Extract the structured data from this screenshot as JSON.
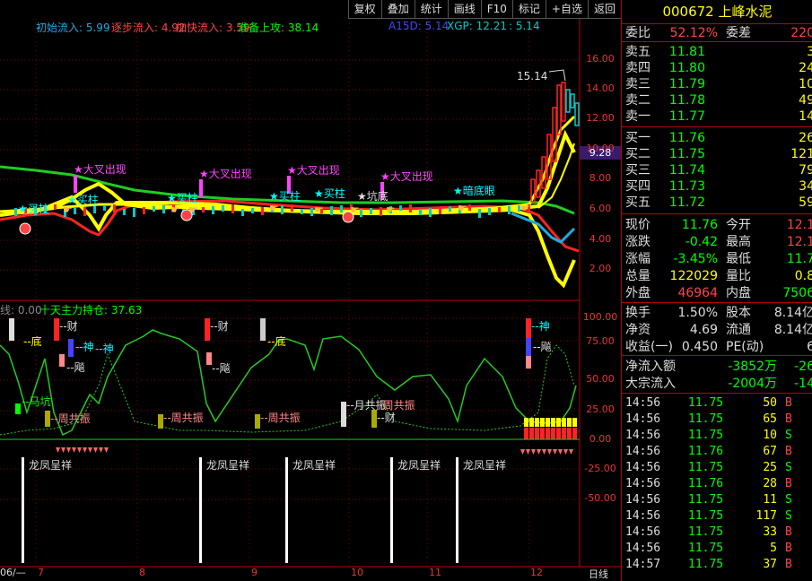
{
  "toolbar": [
    "复权",
    "叠加",
    "统计",
    "画线",
    "F10",
    "标记",
    "+自选",
    "返回"
  ],
  "indicators_top": [
    {
      "label": "初始流入: 5.99",
      "color": "#2ad"
    },
    {
      "label": "逐步流入: 4.92",
      "color": "#f44"
    },
    {
      "label": "加快流入: 3.59",
      "color": "#f44"
    },
    {
      "label": "准备上攻: 38.14",
      "color": "#0f0"
    },
    {
      "label": "A15D: 5.14",
      "color": "#44f"
    },
    {
      "label": "XGP: 12.21",
      "color": "#0cc"
    },
    {
      "label": ": 5.14",
      "color": "#0cc"
    }
  ],
  "top_axis": [
    "16.00",
    "14.00",
    "12.00",
    "10.00",
    "8.00",
    "6.00",
    "4.00",
    "2.00"
  ],
  "price_tag": "9.28",
  "peak_label": "15.14",
  "top_marks": [
    {
      "text": "大叉出现",
      "color": "#f4f"
    },
    {
      "text": "大叉出现",
      "color": "#f4f"
    },
    {
      "text": "大叉出现",
      "color": "#f4f"
    },
    {
      "text": "大叉出现",
      "color": "#f4f"
    },
    {
      "text": "买柱",
      "color": "#0ff"
    },
    {
      "text": "买柱",
      "color": "#0ff"
    },
    {
      "text": "买柱",
      "color": "#0ff"
    },
    {
      "text": "买柱",
      "color": "#0ff"
    },
    {
      "text": "买柱",
      "color": "#0ff"
    },
    {
      "text": "坑底",
      "color": "#ddd"
    },
    {
      "text": "暗底眼",
      "color": "#0ff"
    }
  ],
  "mid_indicators": [
    {
      "label": "线: 0.00",
      "color": "#888"
    },
    {
      "label": "十天主力持仓: 37.63",
      "color": "#0f0"
    }
  ],
  "mid_axis": [
    "100.00",
    "75.00",
    "50.00",
    "25.00",
    "0.00",
    "-25.00",
    "-50.00"
  ],
  "mid_marks": [
    {
      "text": "底",
      "color": "#ff0"
    },
    {
      "text": "财",
      "color": "#ddd"
    },
    {
      "text": "神",
      "color": "#0ff"
    },
    {
      "text": "神",
      "color": "#0ff"
    },
    {
      "text": "飚",
      "color": "#ddd"
    },
    {
      "text": "马坑",
      "color": "#0f0"
    },
    {
      "text": "周共振",
      "color": "#f88"
    },
    {
      "text": "财",
      "color": "#ddd"
    },
    {
      "text": "底",
      "color": "#ff0"
    },
    {
      "text": "飚",
      "color": "#ddd"
    },
    {
      "text": "周共振",
      "color": "#f88"
    },
    {
      "text": "周共振",
      "color": "#f88"
    },
    {
      "text": "月共振",
      "color": "#ddd"
    },
    {
      "text": "周共振",
      "color": "#f88"
    },
    {
      "text": "财",
      "color": "#ddd"
    },
    {
      "text": "神",
      "color": "#0ff"
    },
    {
      "text": "飚",
      "color": "#ddd"
    }
  ],
  "dragon_label": "龙凤呈祥",
  "dragon_count": 5,
  "x_labels": [
    "06/—",
    "7",
    "8",
    "9",
    "10",
    "11",
    "12"
  ],
  "period": "日线",
  "stock": {
    "code": "000672",
    "name": "上峰水泥"
  },
  "weibi": {
    "label": "委比",
    "value": "52.12%",
    "label2": "委差",
    "value2": "220"
  },
  "asks": [
    {
      "label": "卖五",
      "price": "11.81",
      "vol": "3"
    },
    {
      "label": "卖四",
      "price": "11.80",
      "vol": "24"
    },
    {
      "label": "卖三",
      "price": "11.79",
      "vol": "10"
    },
    {
      "label": "卖二",
      "price": "11.78",
      "vol": "49"
    },
    {
      "label": "卖一",
      "price": "11.77",
      "vol": "14"
    }
  ],
  "bids": [
    {
      "label": "买一",
      "price": "11.76",
      "vol": "26"
    },
    {
      "label": "买二",
      "price": "11.75",
      "vol": "121"
    },
    {
      "label": "买三",
      "price": "11.74",
      "vol": "79"
    },
    {
      "label": "买四",
      "price": "11.73",
      "vol": "34"
    },
    {
      "label": "买五",
      "price": "11.72",
      "vol": "59"
    }
  ],
  "quote": [
    {
      "l1": "现价",
      "v1": "11.76",
      "c1": "g",
      "l2": "今开",
      "v2": "12.1",
      "c2": "r"
    },
    {
      "l1": "涨跌",
      "v1": "-0.42",
      "c1": "g",
      "l2": "最高",
      "v2": "12.1",
      "c2": "r"
    },
    {
      "l1": "涨幅",
      "v1": "-3.45%",
      "c1": "g",
      "l2": "最低",
      "v2": "11.7",
      "c2": "g"
    },
    {
      "l1": "总量",
      "v1": "122029",
      "c1": "y",
      "l2": "量比",
      "v2": "0.8",
      "c2": "y"
    },
    {
      "l1": "外盘",
      "v1": "46964",
      "c1": "r",
      "l2": "内盘",
      "v2": "7506",
      "c2": "g"
    }
  ],
  "fund": [
    {
      "l1": "换手",
      "v1": "1.50%",
      "c1": "w",
      "l2": "股本",
      "v2": "8.14亿",
      "c2": "w"
    },
    {
      "l1": "净资",
      "v1": "4.69",
      "c1": "w",
      "l2": "流通",
      "v2": "8.14亿",
      "c2": "w"
    },
    {
      "l1": "收益(一)",
      "v1": "0.450",
      "c1": "w",
      "l2": "PE(动)",
      "v2": "6",
      "c2": "w"
    }
  ],
  "flows": [
    {
      "label": "净流入额",
      "v1": "-3852万",
      "v2": "-26"
    },
    {
      "label": "大宗流入",
      "v1": "-2004万",
      "v2": "-14"
    }
  ],
  "ticks": [
    {
      "time": "14:56",
      "price": "11.75",
      "vol": "50",
      "bs": "B"
    },
    {
      "time": "14:56",
      "price": "11.75",
      "vol": "65",
      "bs": "B"
    },
    {
      "time": "14:56",
      "price": "11.75",
      "vol": "10",
      "bs": "S"
    },
    {
      "time": "14:56",
      "price": "11.76",
      "vol": "67",
      "bs": "B"
    },
    {
      "time": "14:56",
      "price": "11.75",
      "vol": "25",
      "bs": "S"
    },
    {
      "time": "14:56",
      "price": "11.76",
      "vol": "28",
      "bs": "B"
    },
    {
      "time": "14:56",
      "price": "11.75",
      "vol": "11",
      "bs": "S"
    },
    {
      "time": "14:56",
      "price": "11.75",
      "vol": "117",
      "bs": "S"
    },
    {
      "time": "14:56",
      "price": "11.75",
      "vol": "33",
      "bs": "B"
    },
    {
      "time": "14:56",
      "price": "11.75",
      "vol": "5",
      "bs": "B"
    },
    {
      "time": "14:57",
      "price": "11.75",
      "vol": "37",
      "bs": "B"
    }
  ],
  "colors": {
    "grid": "#7a0000",
    "up": "#ff2020",
    "down": "#00c8c8",
    "yellow": "#ffff00",
    "green": "#00d000"
  }
}
